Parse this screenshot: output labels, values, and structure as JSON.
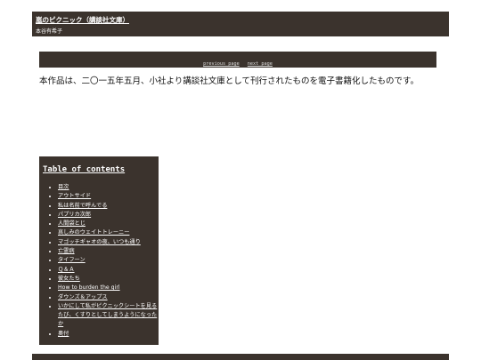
{
  "header": {
    "title": "嵐のピクニック（講談社文庫）",
    "author": "本谷有希子"
  },
  "nav": {
    "previous": "previous page",
    "next": "next page"
  },
  "content": {
    "text": "本作品は、二〇一五年五月、小社より講談社文庫として刊行されたものを電子書籍化したものです。"
  },
  "toc": {
    "title": "Table of contents",
    "items": [
      "目次",
      "アウトサイド",
      "私は名前で呼んでる",
      "パプリカ次郎",
      "人間袋とじ",
      "哀しみのウェイトトレーニー",
      "マゴッチギャオの夜、いつも通り",
      "亡霊病",
      "タイフーン",
      "Ｑ＆Ａ",
      "彼女たち",
      "How to burden the girl",
      "ダウンズ＆アップス",
      "いかにして私がピクニックシートを見るたび、くすりとしてしまうようになったか",
      "奥付"
    ]
  }
}
